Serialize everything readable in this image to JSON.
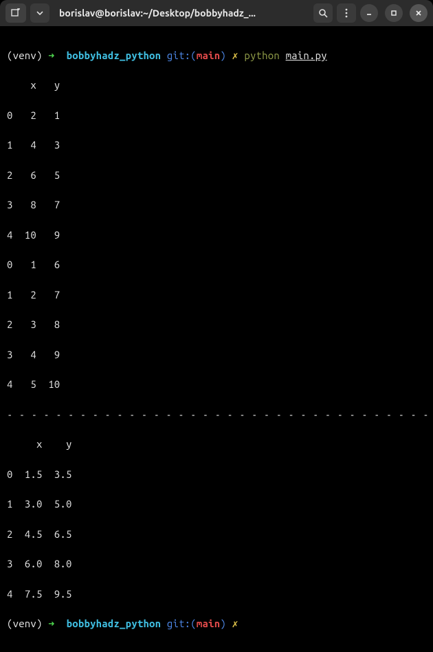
{
  "titlebar": {
    "title": "borislav@borislav:~/Desktop/bobbyhadz_..."
  },
  "prompt1": {
    "venv": "(venv)",
    "arrow": "➜",
    "dir": "bobbyhadz_python",
    "git_label": "git:(",
    "branch": "main",
    "git_close": ")",
    "dirty": "✗",
    "cmd": "python",
    "arg": "main.py"
  },
  "table1": {
    "header": "    x   y",
    "rows": [
      "0   2   1",
      "1   4   3",
      "2   6   5",
      "3   8   7",
      "4  10   9",
      "0   1   6",
      "1   2   7",
      "2   3   8",
      "3   4   9",
      "4   5  10"
    ]
  },
  "divider": "- - - - - - - - - - - - - - - - - - - - - - - - - - - - - - - - - - -",
  "table2": {
    "header": "     x    y",
    "rows": [
      "0  1.5  3.5",
      "1  3.0  5.0",
      "2  4.5  6.5",
      "3  6.0  8.0",
      "4  7.5  9.5"
    ]
  },
  "prompt2": {
    "venv": "(venv)",
    "arrow": "➜",
    "dir": "bobbyhadz_python",
    "git_label": "git:(",
    "branch": "main",
    "git_close": ")",
    "dirty": "✗"
  }
}
